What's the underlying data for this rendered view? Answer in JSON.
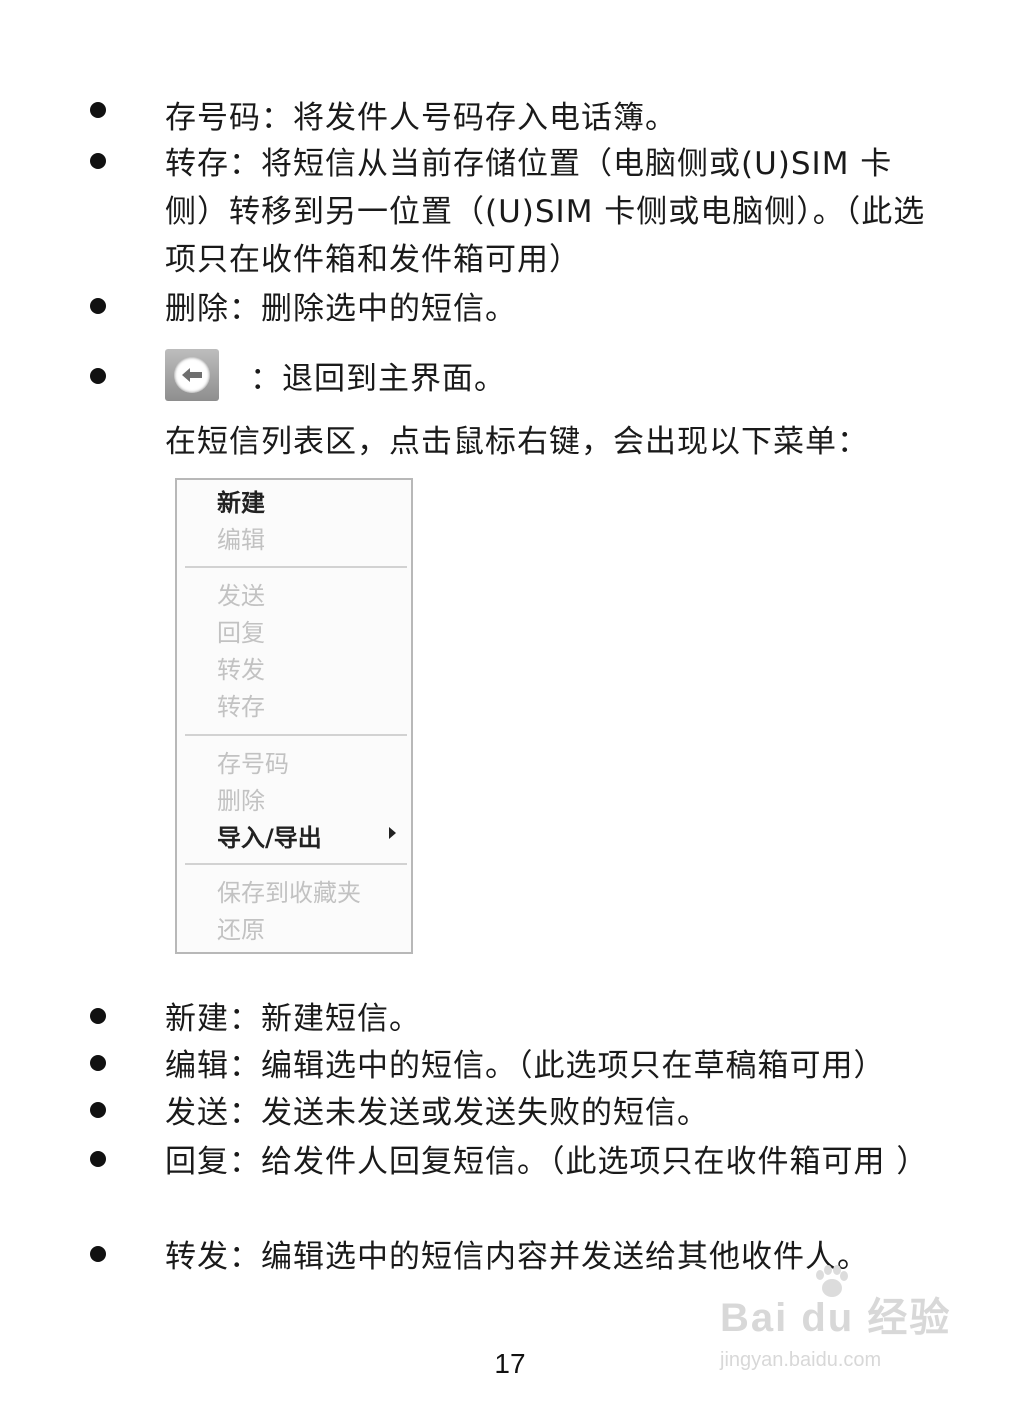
{
  "items_top": [
    {
      "term": "存号码：",
      "desc": "将发件人号码存入电话簿。"
    },
    {
      "term": "转存：",
      "desc": "将短信从当前存储位置（电脑侧或(U)SIM 卡侧）转移到另一位置（(U)SIM 卡侧或电脑侧）。（此选项只在收件箱和发件箱可用）"
    },
    {
      "term": "删除：",
      "desc": "删除选中的短信。"
    },
    {
      "term": "：",
      "desc": "退回到主界面。"
    }
  ],
  "intro_text": "在短信列表区，点击鼠标右键，会出现以下菜单：",
  "menu": {
    "groups": [
      [
        {
          "label": "新建",
          "enabled": true
        },
        {
          "label": "编辑",
          "enabled": false
        }
      ],
      [
        {
          "label": "发送",
          "enabled": false
        },
        {
          "label": "回复",
          "enabled": false
        },
        {
          "label": "转发",
          "enabled": false
        },
        {
          "label": "转存",
          "enabled": false
        }
      ],
      [
        {
          "label": "存号码",
          "enabled": false
        },
        {
          "label": "删除",
          "enabled": false
        },
        {
          "label": "导入/导出",
          "enabled": true,
          "submenu": true
        }
      ],
      [
        {
          "label": "保存到收藏夹",
          "enabled": false
        },
        {
          "label": "还原",
          "enabled": false
        }
      ]
    ]
  },
  "items_bottom": [
    {
      "term": "新建：",
      "desc": "新建短信。"
    },
    {
      "term": "编辑：",
      "desc": "编辑选中的短信。（此选项只在草稿箱可用）"
    },
    {
      "term": "发送：",
      "desc": "发送未发送或发送失败的短信。"
    },
    {
      "term": "回复：",
      "desc": "给发件人回复短信。（此选项只在收件箱可用 ）"
    },
    {
      "term": "转发：",
      "desc": "编辑选中的短信内容并发送给其他收件人。"
    }
  ],
  "page_number": "17",
  "watermark": {
    "main": "Bai du 经验",
    "url": "jingyan.baidu.com"
  },
  "icons": {
    "back_button": "back-arrow-icon",
    "submenu": "submenu-arrow-icon",
    "watermark_logo": "paw-icon"
  }
}
